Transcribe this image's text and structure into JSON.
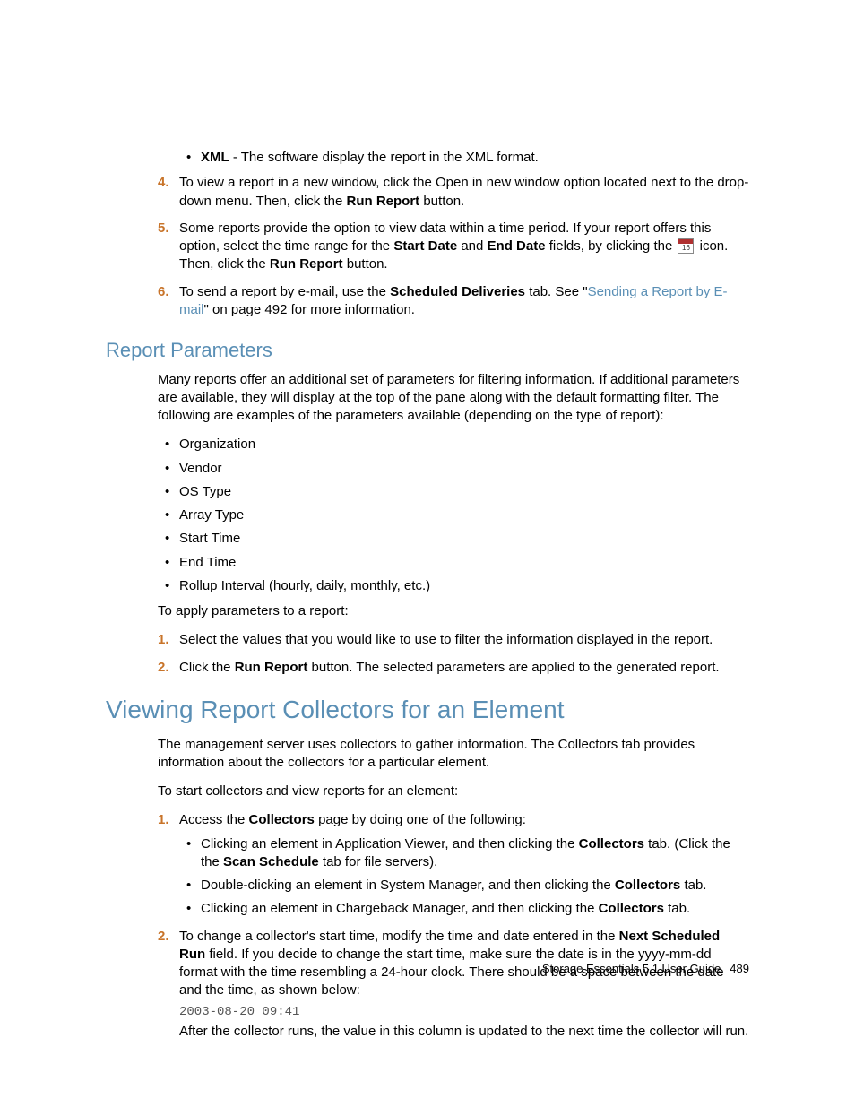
{
  "topList": {
    "xmlBullet": {
      "bold": "XML",
      "rest": " - The software display the report in the XML format."
    },
    "item4": {
      "num": "4.",
      "part1": "To view a report in a new window, click the Open in new window option located next to the drop-down menu. Then, click the ",
      "bold1": "Run Report",
      "part2": " button."
    },
    "item5": {
      "num": "5.",
      "part1": "Some reports provide the option to view data within a time period. If your report offers this option, select the time range for the ",
      "bold1": "Start Date",
      "mid1": " and ",
      "bold2": "End Date",
      "mid2": " fields, by clicking the ",
      "mid3": " icon. Then, click the ",
      "bold3": "Run Report",
      "part2": " button."
    },
    "item6": {
      "num": "6.",
      "part1": "To send a report by e-mail, use the ",
      "bold1": "Scheduled Deliveries",
      "mid1": " tab. See \"",
      "link": "Sending a Report by E-mail",
      "part2": "\" on page 492 for more information."
    }
  },
  "reportParams": {
    "heading": "Report Parameters",
    "intro": "Many reports offer an additional set of parameters for filtering information. If additional parameters are available, they will display at the top of the pane along with the default formatting filter. The following are examples of the parameters available (depending on the type of report):",
    "bullets": [
      "Organization",
      "Vendor",
      "OS Type",
      "Array Type",
      "Start Time",
      "End Time",
      "Rollup Interval (hourly, daily, monthly, etc.)"
    ],
    "apply": "To apply parameters to a report:",
    "step1": {
      "num": "1.",
      "text": "Select the values that you would like to use to filter the information displayed in the report."
    },
    "step2": {
      "num": "2.",
      "part1": "Click the ",
      "bold1": "Run Report",
      "part2": " button. The selected parameters are applied to the generated report."
    }
  },
  "collectors": {
    "heading": "Viewing Report Collectors for an Element",
    "intro": "The management server uses collectors to gather information. The Collectors tab provides information about the collectors for a particular element.",
    "start": "To start collectors and view reports for an element:",
    "step1": {
      "num": "1.",
      "part1": "Access the ",
      "bold1": "Collectors",
      "part2": " page by doing one of the following:",
      "sub1": {
        "p1": "Clicking an element in Application Viewer, and then clicking the ",
        "b1": "Collectors",
        "p2": " tab. (Click the the ",
        "b2": "Scan Schedule",
        "p3": " tab for file servers)."
      },
      "sub2": {
        "p1": "Double-clicking an element in System Manager, and then clicking the ",
        "b1": "Collectors",
        "p2": " tab."
      },
      "sub3": {
        "p1": "Clicking an element in Chargeback Manager, and then clicking the ",
        "b1": "Collectors",
        "p2": " tab."
      }
    },
    "step2": {
      "num": "2.",
      "p1": "To change a collector's start time, modify the time and date entered in the ",
      "b1": "Next Scheduled Run",
      "p2": " field. If you decide to change the start time, make sure the date is in the yyyy-mm-dd format with the time resembling a 24-hour clock. There should be a space between the date and the time, as shown below:",
      "code": "2003-08-20 09:41",
      "after": "After the collector runs, the value in this column is updated to the next time the collector will run."
    }
  },
  "footer": {
    "title": "Storage Essentials 5.1 User Guide",
    "page": "489"
  }
}
